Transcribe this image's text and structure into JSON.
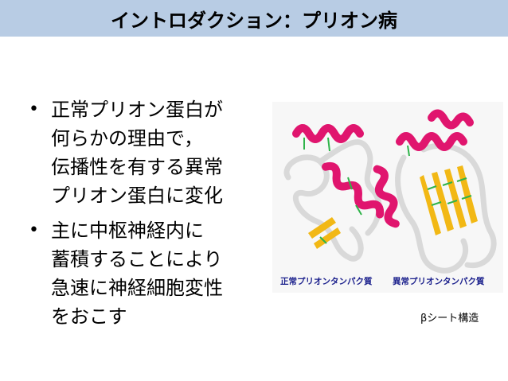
{
  "slide": {
    "title": "イントロダクション：プリオン病"
  },
  "bullets": [
    {
      "lines": [
        "正常プリオン蛋白が",
        "何らかの理由で，",
        "伝播性を有する異常",
        "プリオン蛋白に変化"
      ]
    },
    {
      "lines": [
        "主に中枢神経内に",
        "蓄積することにより",
        "急速に神経細胞変性",
        "をおこす"
      ]
    }
  ],
  "figure": {
    "caption_normal": "正常プリオンタンパク質",
    "caption_abnormal": "異常プリオンタンパク質",
    "beta_label": "βシート構造",
    "colors": {
      "helix": "#e0156e",
      "sheet": "#f2b815",
      "coil": "#d9d9d9",
      "hbond": "#2fb34a"
    }
  }
}
